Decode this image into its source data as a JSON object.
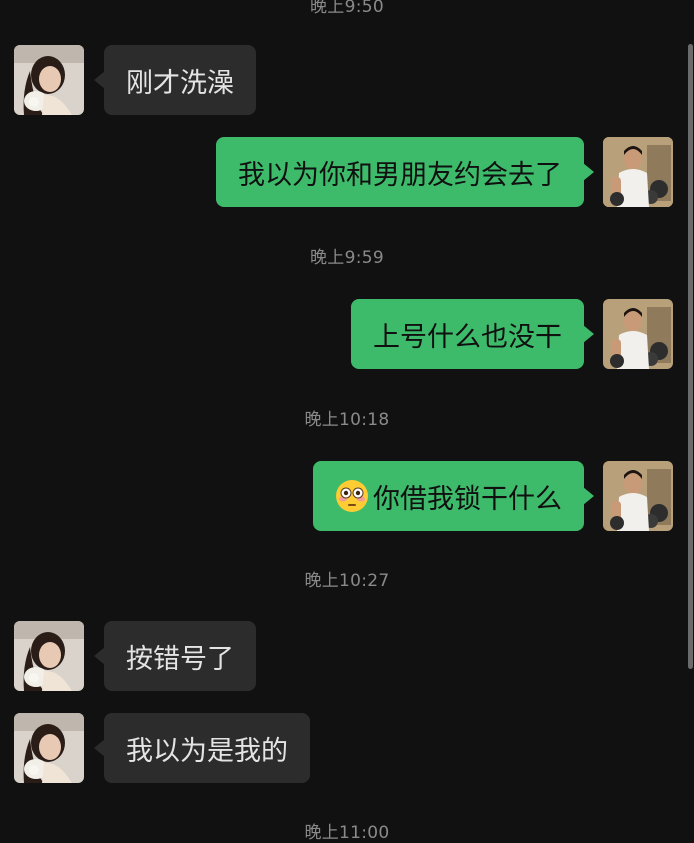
{
  "timestamps": {
    "t0": "晚上9:50",
    "t1": "晚上9:59",
    "t2": "晚上10:18",
    "t3": "晚上10:27",
    "t4": "晚上11:00"
  },
  "messages": {
    "m1": "刚才洗澡",
    "m2": "我以为你和男朋友约会去了",
    "m3": "上号什么也没干",
    "m4": "你借我锁干什么",
    "m5": "按错号了",
    "m6": "我以为是我的"
  },
  "icons": {
    "m4_prefix": "flushed-face-emoji"
  },
  "colors": {
    "background": "#111111",
    "incoming_bubble": "#2c2c2c",
    "outgoing_bubble": "#3dbb6b",
    "timestamp_text": "#8a8a8a"
  }
}
